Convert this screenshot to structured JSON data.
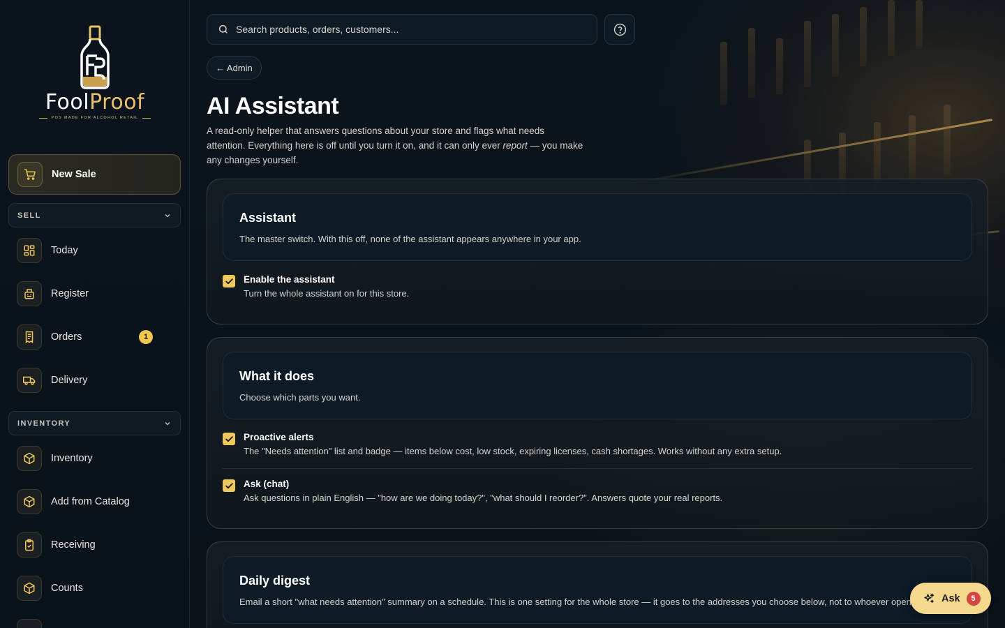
{
  "brand": {
    "name_part1": "Fool",
    "name_part2": "Proof",
    "tagline": "POS MADE FOR ALCOHOL RETAIL",
    "accent": "#f0c75a"
  },
  "sidebar": {
    "new_sale": {
      "label": "New Sale",
      "icon": "cart-icon"
    },
    "sections": [
      {
        "title": "SELL",
        "items": [
          {
            "label": "Today",
            "icon": "dashboard-icon"
          },
          {
            "label": "Register",
            "icon": "register-icon"
          },
          {
            "label": "Orders",
            "icon": "receipt-icon",
            "badge": "1"
          },
          {
            "label": "Delivery",
            "icon": "truck-icon"
          }
        ]
      },
      {
        "title": "INVENTORY",
        "items": [
          {
            "label": "Inventory",
            "icon": "box-icon"
          },
          {
            "label": "Add from Catalog",
            "icon": "box-icon"
          },
          {
            "label": "Receiving",
            "icon": "clipboard-check-icon"
          },
          {
            "label": "Counts",
            "icon": "box-icon"
          }
        ]
      }
    ]
  },
  "header": {
    "search_placeholder": "Search products, orders, customers...",
    "help_icon": "help-circle-icon",
    "back_label": "← Admin"
  },
  "page": {
    "title": "AI Assistant",
    "desc_part1": "A read-only helper that answers questions about your store and flags what needs attention. Everything here is off until you turn it on, and it can only ever ",
    "desc_em": "report",
    "desc_part2": " — you make any changes yourself."
  },
  "cards": {
    "assistant": {
      "title": "Assistant",
      "subtitle": "The master switch. With this off, none of the assistant appears anywhere in your app.",
      "options": [
        {
          "title": "Enable the assistant",
          "desc": "Turn the whole assistant on for this store.",
          "checked": true
        }
      ]
    },
    "what_it_does": {
      "title": "What it does",
      "subtitle": "Choose which parts you want.",
      "options": [
        {
          "title": "Proactive alerts",
          "desc": "The \"Needs attention\" list and badge — items below cost, low stock, expiring licenses, cash shortages. Works without any extra setup.",
          "checked": true
        },
        {
          "title": "Ask (chat)",
          "desc": "Ask questions in plain English — \"how are we doing today?\", \"what should I reorder?\". Answers quote your real reports.",
          "checked": true
        }
      ]
    },
    "daily_digest": {
      "title": "Daily digest",
      "subtitle": "Email a short \"what needs attention\" summary on a schedule. This is one setting for the whole store — it goes to the addresses you choose below, not to whoever opens"
    }
  },
  "ask_fab": {
    "label": "Ask",
    "badge": "5",
    "icon": "sparkle-icon"
  }
}
